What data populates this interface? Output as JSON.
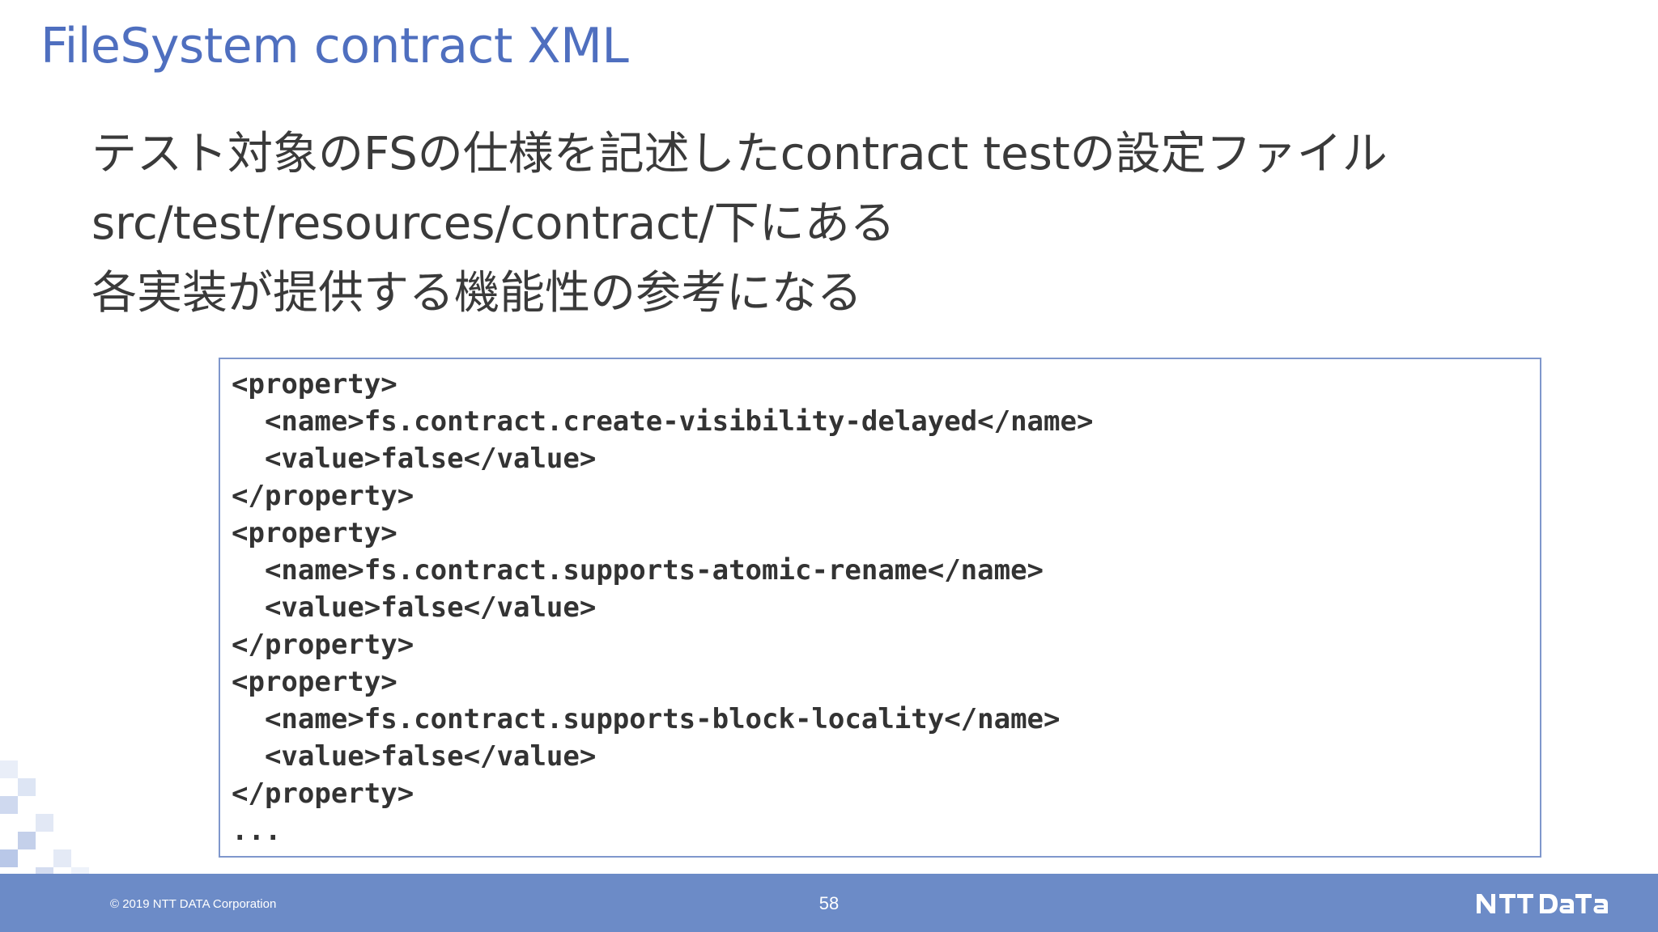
{
  "slide": {
    "title": "FileSystem contract XML",
    "bullets": [
      "テスト対象のFSの仕様を記述したcontract testの設定ファイル",
      "src/test/resources/contract/下にある",
      "各実装が提供する機能性の参考になる"
    ],
    "code_lines": [
      "<property>",
      "  <name>fs.contract.create-visibility-delayed</name>",
      "  <value>false</value>",
      "</property>",
      "<property>",
      "  <name>fs.contract.supports-atomic-rename</name>",
      "  <value>false</value>",
      "</property>",
      "<property>",
      "  <name>fs.contract.supports-block-locality</name>",
      "  <value>false</value>",
      "</property>",
      "..."
    ]
  },
  "footer": {
    "copyright": "© 2019 NTT DATA Corporation",
    "page_number": "58",
    "logo_text": "NTT DATA"
  },
  "colors": {
    "title": "#4f6fbf",
    "footer_bg": "#6c8bc7",
    "code_border": "#7f97cc",
    "body_text": "#3a3a3a"
  }
}
